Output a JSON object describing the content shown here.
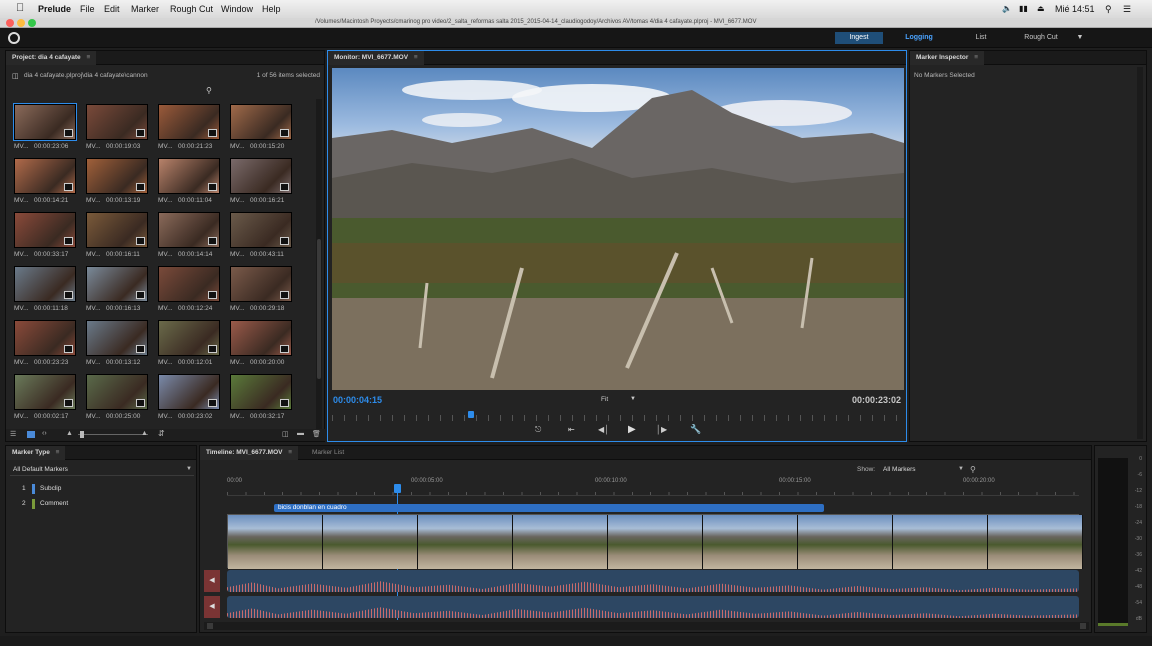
{
  "menubar": {
    "apple": "",
    "app_name": "Prelude",
    "items": [
      "File",
      "Edit",
      "Marker",
      "Rough Cut",
      "Window",
      "Help"
    ],
    "clock": "Mié 14:51"
  },
  "window_title": "/Volumes/Macintosh Proyects/cmarinog pro video/2_salta_reformas salta 2015_2015-04-14_claudiogodoy/Archivos AV/tomas 4/dia 4 cafayate.plproj - MVI_6677.MOV",
  "modes": {
    "ingest": "Ingest",
    "logging": "Logging",
    "list": "List",
    "rough_cut": "Rough Cut"
  },
  "project": {
    "title": "Project: dia 4 cafayate",
    "menu_glyph": "≡",
    "path": "dia 4 cafayate.plproj\\dia 4 cafayate\\cannon",
    "selection": "1 of 56 items selected",
    "thumbs": [
      {
        "name": "MV...",
        "time": "00:00:23:06",
        "color": "#8a6a5a"
      },
      {
        "name": "MV...",
        "time": "00:00:19:03",
        "color": "#7a4a3a"
      },
      {
        "name": "MV...",
        "time": "00:00:21:23",
        "color": "#9a5a3a"
      },
      {
        "name": "MV...",
        "time": "00:00:15:20",
        "color": "#a06a4a"
      },
      {
        "name": "MV...",
        "time": "00:00:14:21",
        "color": "#b06a4a"
      },
      {
        "name": "MV...",
        "time": "00:00:13:19",
        "color": "#a0603a"
      },
      {
        "name": "MV...",
        "time": "00:00:11:04",
        "color": "#b8826a"
      },
      {
        "name": "MV...",
        "time": "00:00:16:21",
        "color": "#7a6a6a"
      },
      {
        "name": "MV...",
        "time": "00:00:33:17",
        "color": "#8a4a3a"
      },
      {
        "name": "MV...",
        "time": "00:00:16:11",
        "color": "#7a5a3a"
      },
      {
        "name": "MV...",
        "time": "00:00:14:14",
        "color": "#8a6a5a"
      },
      {
        "name": "MV...",
        "time": "00:00:43:11",
        "color": "#6a5a4a"
      },
      {
        "name": "MV...",
        "time": "00:00:11:18",
        "color": "#6a7a8a"
      },
      {
        "name": "MV...",
        "time": "00:00:16:13",
        "color": "#7a8a9a"
      },
      {
        "name": "MV...",
        "time": "00:00:12:24",
        "color": "#7a4a3a"
      },
      {
        "name": "MV...",
        "time": "00:00:29:18",
        "color": "#7a5a4a"
      },
      {
        "name": "MV...",
        "time": "00:00:23:23",
        "color": "#8a4a3a"
      },
      {
        "name": "MV...",
        "time": "00:00:13:12",
        "color": "#6a7a8a"
      },
      {
        "name": "MV...",
        "time": "00:00:12:01",
        "color": "#6a6a4a"
      },
      {
        "name": "MV...",
        "time": "00:00:20:00",
        "color": "#9a5a4a"
      },
      {
        "name": "MV...",
        "time": "00:00:02:17",
        "color": "#6a7a5a"
      },
      {
        "name": "MV...",
        "time": "00:00:25:00",
        "color": "#5a6a4a"
      },
      {
        "name": "MV...",
        "time": "00:00:23:02",
        "color": "#7a8aaa"
      },
      {
        "name": "MV...",
        "time": "00:00:32:17",
        "color": "#5a7a3a"
      }
    ]
  },
  "monitor": {
    "title": "Monitor: MVI_6677.MOV",
    "menu_glyph": "≡",
    "current_time": "00:00:04:15",
    "duration": "00:00:23:02",
    "zoom": "Fit",
    "playhead_fraction": 0.2
  },
  "inspector": {
    "title": "Marker Inspector",
    "menu_glyph": "≡",
    "empty_text": "No Markers Selected"
  },
  "marker_type": {
    "title": "Marker Type",
    "menu_glyph": "≡",
    "dropdown": "All Default Markers",
    "items": [
      {
        "num": "1",
        "label": "Subclip",
        "color": "#4a8ad8"
      },
      {
        "num": "2",
        "label": "Comment",
        "color": "#7a9a3a"
      }
    ]
  },
  "timeline": {
    "title": "Timeline: MVI_6677.MOV",
    "menu_glyph": "≡",
    "marker_list_tab": "Marker List",
    "show_label": "Show:",
    "show_value": "All Markers",
    "ticks": [
      "00:00",
      "00:00:05:00",
      "00:00:10:00",
      "00:00:15:00",
      "00:00:20:00"
    ],
    "subclip_label": "bicis donblan en cuadro"
  },
  "meter": {
    "labels": [
      "0",
      "-6",
      "-12",
      "-18",
      "-24",
      "-30",
      "-36",
      "-42",
      "-48",
      "-54",
      "dB"
    ]
  },
  "colors": {
    "accent": "#2d8ceb",
    "ingest_bg": "#1f4e78",
    "subclip_bar": "#2e6fc4",
    "audio_track": "#2d4763"
  }
}
